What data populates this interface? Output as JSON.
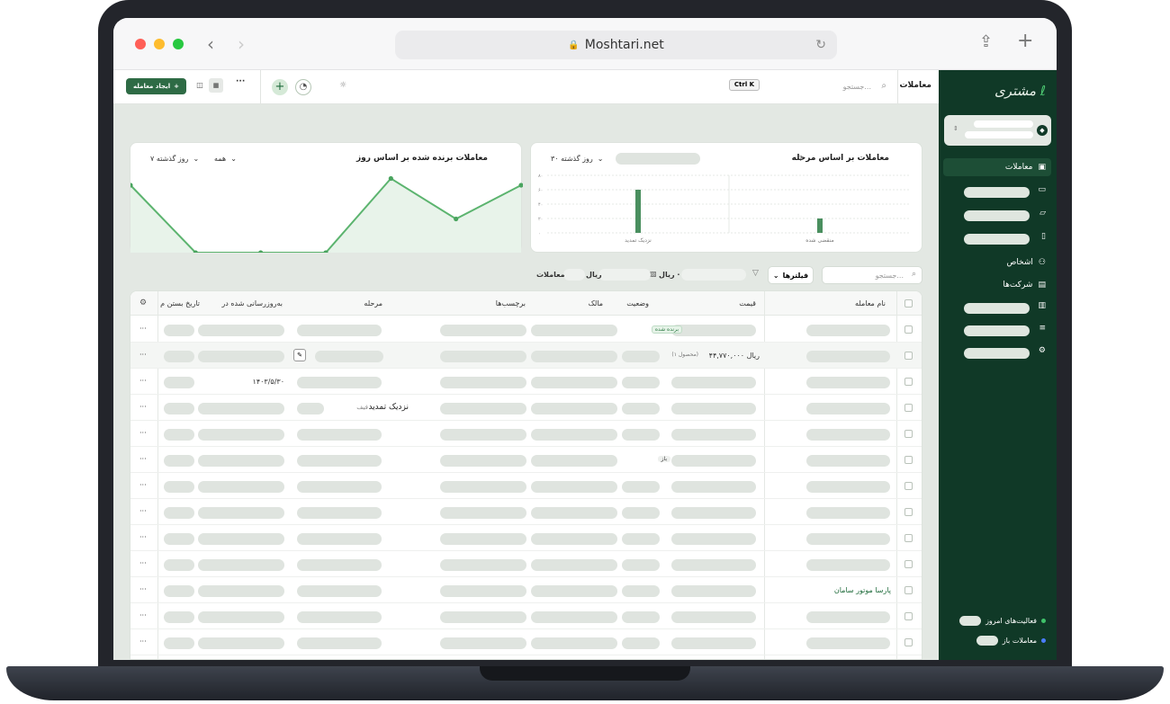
{
  "browser": {
    "url": "Moshtari.net"
  },
  "header": {
    "page_title": "معاملات",
    "search_placeholder": "جستجو...",
    "shortcut": "Ctrl K",
    "create_button": "ایجاد معامله"
  },
  "sidebar": {
    "logo": "مشتری",
    "items": [
      {
        "label": "معاملات",
        "icon": "wallet-icon"
      },
      {
        "label": "اشخاص",
        "icon": "people-icon"
      },
      {
        "label": "شرکت‌ها",
        "icon": "building-icon"
      }
    ],
    "footer": [
      {
        "label": "فعالیت‌های امروز",
        "color": "#3fc26a"
      },
      {
        "label": "معاملات باز",
        "color": "#4a7dff"
      }
    ]
  },
  "chart_stage": {
    "title": "معاملات بر اساس مرحله",
    "range": "۳۰ روز گذشته",
    "chart_data": {
      "type": "bar",
      "categories": [
        "نزدیک تمدید",
        "منقضی شده"
      ],
      "values": [
        60,
        20
      ],
      "ylim": [
        0,
        80
      ],
      "yticks": [
        "۸۰",
        "۶۰",
        "۴۰",
        "۲۰",
        "۰"
      ]
    }
  },
  "chart_won": {
    "title": "معاملات برنده شده بر اساس روز",
    "filter_all": "همه",
    "range": "۷ روز گذشته",
    "chart_data": {
      "type": "area",
      "values": [
        1,
        0,
        0,
        0,
        1.1,
        0.5,
        1
      ],
      "ylim": [
        0,
        1.2
      ]
    }
  },
  "filters": {
    "search_placeholder": "جستجو...",
    "filters_button": "فیلترها",
    "rial_label_1": "ریال ·",
    "rial_label_2": "ریال",
    "deals_label": "معاملات"
  },
  "table": {
    "columns": [
      "نام معامله",
      "قیمت",
      "وضعیت",
      "مالک",
      "برچسب‌ها",
      "مرحله",
      "به‌روزرسانی شده در",
      "تاریخ بستن م"
    ],
    "status_won": "برنده شده",
    "status_open": "باز",
    "price_row": "۴۴,۷۷۰,۰۰۰ ریال",
    "price_note": "(۱ محصول)",
    "date_value": "۱۴۰۳/۵/۳۰",
    "stage_value": "نزدیک تمدید",
    "stage_prefix": "فیف",
    "company_name": "پارسا موتور سامان",
    "more": "···"
  }
}
